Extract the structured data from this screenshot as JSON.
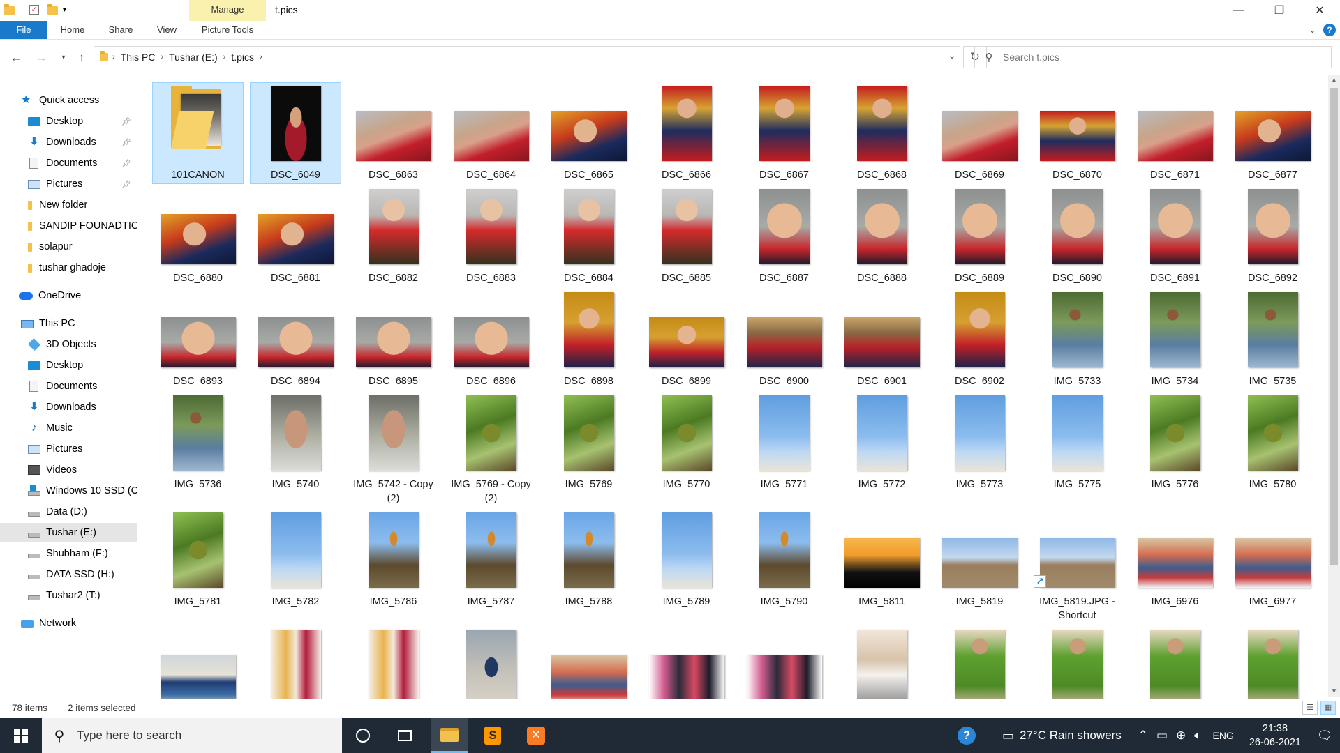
{
  "window": {
    "title": "t.pics",
    "manage_label": "Manage",
    "controls": {
      "minimize": "—",
      "maximize": "❐",
      "close": "✕"
    }
  },
  "ribbon": {
    "tabs": [
      {
        "label": "File"
      },
      {
        "label": "Home"
      },
      {
        "label": "Share"
      },
      {
        "label": "View"
      },
      {
        "label": "Picture Tools"
      }
    ]
  },
  "address": {
    "crumbs": [
      "This PC",
      "Tushar (E:)",
      "t.pics"
    ],
    "search_placeholder": "Search t.pics"
  },
  "sidebar": {
    "items": [
      {
        "label": "Quick access",
        "icon": "star-icon",
        "pinned": false
      },
      {
        "label": "Desktop",
        "icon": "desktop-icon",
        "pinned": true
      },
      {
        "label": "Downloads",
        "icon": "downloads-icon",
        "pinned": true
      },
      {
        "label": "Documents",
        "icon": "documents-icon",
        "pinned": true
      },
      {
        "label": "Pictures",
        "icon": "pictures-icon",
        "pinned": true
      },
      {
        "label": "New folder",
        "icon": "folder-icon",
        "pinned": false
      },
      {
        "label": "SANDIP FOUNADTIO",
        "icon": "folder-icon",
        "pinned": false
      },
      {
        "label": "solapur",
        "icon": "folder-icon",
        "pinned": false
      },
      {
        "label": "tushar ghadoje",
        "icon": "folder-icon",
        "pinned": false
      },
      {
        "label": "OneDrive",
        "icon": "onedrive-icon",
        "pinned": false
      },
      {
        "label": "This PC",
        "icon": "this-pc-icon",
        "pinned": false
      },
      {
        "label": "3D Objects",
        "icon": "3d-objects-icon",
        "pinned": false
      },
      {
        "label": "Desktop",
        "icon": "desktop-icon",
        "pinned": false
      },
      {
        "label": "Documents",
        "icon": "documents-icon",
        "pinned": false
      },
      {
        "label": "Downloads",
        "icon": "downloads-icon",
        "pinned": false
      },
      {
        "label": "Music",
        "icon": "music-icon",
        "pinned": false
      },
      {
        "label": "Pictures",
        "icon": "pictures-icon",
        "pinned": false
      },
      {
        "label": "Videos",
        "icon": "videos-icon",
        "pinned": false
      },
      {
        "label": "Windows 10 SSD (C",
        "icon": "windows-drive-icon",
        "pinned": false
      },
      {
        "label": "Data (D:)",
        "icon": "drive-icon",
        "pinned": false
      },
      {
        "label": "Tushar (E:)",
        "icon": "drive-icon",
        "pinned": false,
        "selected": true
      },
      {
        "label": "Shubham (F:)",
        "icon": "drive-icon",
        "pinned": false
      },
      {
        "label": "DATA SSD (H:)",
        "icon": "drive-icon",
        "pinned": false
      },
      {
        "label": "Tushar2 (T:)",
        "icon": "drive-icon",
        "pinned": false
      },
      {
        "label": "Network",
        "icon": "network-icon",
        "pinned": false
      }
    ]
  },
  "files": [
    {
      "name": "101CANON",
      "kind": "folder",
      "selected": true
    },
    {
      "name": "DSC_6049",
      "kind": "woman",
      "orient": "p",
      "selected": true
    },
    {
      "name": "DSC_6863",
      "kind": "baby-red",
      "orient": "l"
    },
    {
      "name": "DSC_6864",
      "kind": "baby-red",
      "orient": "l"
    },
    {
      "name": "DSC_6865",
      "kind": "baby-dark",
      "orient": "l"
    },
    {
      "name": "DSC_6866",
      "kind": "baby-red-rug",
      "orient": "p"
    },
    {
      "name": "DSC_6867",
      "kind": "baby-red-rug",
      "orient": "p"
    },
    {
      "name": "DSC_6868",
      "kind": "baby-red-rug",
      "orient": "p"
    },
    {
      "name": "DSC_6869",
      "kind": "baby-red",
      "orient": "l"
    },
    {
      "name": "DSC_6870",
      "kind": "baby-red-rug",
      "orient": "l"
    },
    {
      "name": "DSC_6871",
      "kind": "baby-red",
      "orient": "l"
    },
    {
      "name": "DSC_6877",
      "kind": "baby-dark",
      "orient": "l"
    },
    {
      "name": "DSC_6880",
      "kind": "baby-dark",
      "orient": "l"
    },
    {
      "name": "DSC_6881",
      "kind": "baby-dark",
      "orient": "l"
    },
    {
      "name": "DSC_6882",
      "kind": "baby-sit",
      "orient": "p"
    },
    {
      "name": "DSC_6883",
      "kind": "baby-sit",
      "orient": "p"
    },
    {
      "name": "DSC_6884",
      "kind": "baby-sit",
      "orient": "p"
    },
    {
      "name": "DSC_6885",
      "kind": "baby-sit",
      "orient": "p"
    },
    {
      "name": "DSC_6887",
      "kind": "baby-close",
      "orient": "p"
    },
    {
      "name": "DSC_6888",
      "kind": "baby-close",
      "orient": "p"
    },
    {
      "name": "DSC_6889",
      "kind": "baby-close",
      "orient": "p"
    },
    {
      "name": "DSC_6890",
      "kind": "baby-close",
      "orient": "p"
    },
    {
      "name": "DSC_6891",
      "kind": "baby-close",
      "orient": "p"
    },
    {
      "name": "DSC_6892",
      "kind": "baby-close",
      "orient": "p"
    },
    {
      "name": "DSC_6893",
      "kind": "baby-close",
      "orient": "l"
    },
    {
      "name": "DSC_6894",
      "kind": "baby-close",
      "orient": "l"
    },
    {
      "name": "DSC_6895",
      "kind": "baby-close",
      "orient": "l"
    },
    {
      "name": "DSC_6896",
      "kind": "baby-close",
      "orient": "l"
    },
    {
      "name": "DSC_6898",
      "kind": "baby-gold",
      "orient": "p"
    },
    {
      "name": "DSC_6899",
      "kind": "baby-gold",
      "orient": "l"
    },
    {
      "name": "DSC_6900",
      "kind": "baby-lie",
      "orient": "l"
    },
    {
      "name": "DSC_6901",
      "kind": "baby-lie",
      "orient": "l"
    },
    {
      "name": "DSC_6902",
      "kind": "baby-gold",
      "orient": "p"
    },
    {
      "name": "IMG_5733",
      "kind": "man-trees",
      "orient": "p"
    },
    {
      "name": "IMG_5734",
      "kind": "man-trees",
      "orient": "p"
    },
    {
      "name": "IMG_5735",
      "kind": "man-trees",
      "orient": "p"
    },
    {
      "name": "IMG_5736",
      "kind": "man-trees",
      "orient": "p"
    },
    {
      "name": "IMG_5740",
      "kind": "man-face",
      "orient": "p"
    },
    {
      "name": "IMG_5742 - Copy (2)",
      "kind": "man-face",
      "orient": "p"
    },
    {
      "name": "IMG_5769 - Copy (2)",
      "kind": "coco",
      "orient": "p"
    },
    {
      "name": "IMG_5769",
      "kind": "coco",
      "orient": "p"
    },
    {
      "name": "IMG_5770",
      "kind": "coco",
      "orient": "p"
    },
    {
      "name": "IMG_5771",
      "kind": "palm-sky",
      "orient": "p"
    },
    {
      "name": "IMG_5772",
      "kind": "palm-sky",
      "orient": "p"
    },
    {
      "name": "IMG_5773",
      "kind": "palm-sky",
      "orient": "p"
    },
    {
      "name": "IMG_5775",
      "kind": "palm-sky",
      "orient": "p"
    },
    {
      "name": "IMG_5776",
      "kind": "coco",
      "orient": "p"
    },
    {
      "name": "IMG_5780",
      "kind": "coco",
      "orient": "p"
    },
    {
      "name": "IMG_5781",
      "kind": "coco",
      "orient": "p"
    },
    {
      "name": "IMG_5782",
      "kind": "palm-sky",
      "orient": "p"
    },
    {
      "name": "IMG_5786",
      "kind": "climb",
      "orient": "p"
    },
    {
      "name": "IMG_5787",
      "kind": "climb",
      "orient": "p"
    },
    {
      "name": "IMG_5788",
      "kind": "climb",
      "orient": "p"
    },
    {
      "name": "IMG_5789",
      "kind": "palm-sky",
      "orient": "p"
    },
    {
      "name": "IMG_5790",
      "kind": "climb",
      "orient": "p"
    },
    {
      "name": "IMG_5811",
      "kind": "sunset",
      "orient": "l"
    },
    {
      "name": "IMG_5819",
      "kind": "ground",
      "orient": "l"
    },
    {
      "name": "IMG_5819.JPG - Shortcut",
      "kind": "ground",
      "orient": "l",
      "shortcut": true
    },
    {
      "name": "IMG_6976",
      "kind": "group",
      "orient": "l"
    },
    {
      "name": "IMG_6977",
      "kind": "group",
      "orient": "l"
    },
    {
      "name": "",
      "kind": "building",
      "orient": "l"
    },
    {
      "name": "",
      "kind": "women2",
      "orient": "p"
    },
    {
      "name": "",
      "kind": "women2",
      "orient": "p"
    },
    {
      "name": "",
      "kind": "man-stand",
      "orient": "p"
    },
    {
      "name": "",
      "kind": "group",
      "orient": "l"
    },
    {
      "name": "",
      "kind": "women5",
      "orient": "l"
    },
    {
      "name": "",
      "kind": "women5",
      "orient": "l"
    },
    {
      "name": "",
      "kind": "pandit",
      "orient": "p"
    },
    {
      "name": "",
      "kind": "kid-green",
      "orient": "p"
    },
    {
      "name": "",
      "kind": "kid-green",
      "orient": "p"
    },
    {
      "name": "",
      "kind": "kid-green",
      "orient": "p"
    },
    {
      "name": "",
      "kind": "kid-green",
      "orient": "p"
    }
  ],
  "status": {
    "item_count": "78 items",
    "selection": "2 items selected"
  },
  "taskbar": {
    "search_placeholder": "Type here to search",
    "weather": "27°C  Rain showers",
    "language": "ENG",
    "time": "21:38",
    "date": "26-06-2021"
  }
}
